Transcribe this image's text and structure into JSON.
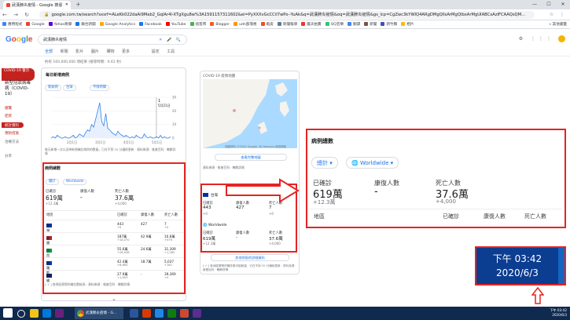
{
  "browser": {
    "tab_title": "武漢肺炎疫情 - Google 搜尋",
    "new_tab": "+",
    "url": "google.com.tw/search?sxsrf=ALeKk022daAi9Mab2_GqlAr4l-XTgXgu8w%3A1591157311602&ei=PyXXXvGcCCiI7wPo--YuAk&q=武漢肺炎疫情&oq=武漢肺炎疫情&gs_lcp=CgZwc3kYWlQ4ARgDMgQIlsArMgQIbxArMgUIABCxAzlFCAAQsQM...",
    "nav": "← → ↻",
    "right_icons": "☆ ⋮",
    "window_buttons": [
      "—",
      "☐",
      "✕"
    ]
  },
  "bookmarks": [
    {
      "label": "應用程式",
      "color": "#4285f4"
    },
    {
      "label": "Google",
      "color": "#ea4335"
    },
    {
      "label": "Yahoo奇摩",
      "color": "#6001d2"
    },
    {
      "label": "聯合新聞",
      "color": "#1a73e8"
    },
    {
      "label": "Google Analytics",
      "color": "#f9ab00"
    },
    {
      "label": "Facebook",
      "color": "#1877f2"
    },
    {
      "label": "YouTube",
      "color": "#ff0000"
    },
    {
      "label": "痞客邦",
      "color": "#4caf50"
    },
    {
      "label": "Blogger",
      "color": "#ff5722"
    },
    {
      "label": "udn部落格",
      "color": "#ff9800"
    },
    {
      "label": "蝦皮",
      "color": "#ee4d2d"
    },
    {
      "label": "新聞報導",
      "color": "#607d8b"
    },
    {
      "label": "露天拍賣",
      "color": "#e53935"
    },
    {
      "label": "QQ音樂",
      "color": "#31c27c"
    },
    {
      "label": "翻譯",
      "color": "#4285f4"
    },
    {
      "label": "新聞",
      "color": "#795548"
    },
    {
      "label": "新竹縣",
      "color": "#3f51b5"
    },
    {
      "label": "相片",
      "color": "#fbbc05"
    }
  ],
  "bookmarks_more": "» 其他書籤",
  "google": {
    "logo": [
      "G",
      "o",
      "o",
      "g",
      "l",
      "e"
    ],
    "query": "武漢肺炎疫情",
    "search_icons": "✕ 🎤 🔍",
    "header_right": "⚙ ⋮⋮⋮",
    "tabs": [
      "全部",
      "新聞",
      "影片",
      "圖片",
      "購物",
      "更多",
      "設定",
      "工具"
    ],
    "result_stats": "約有 160,000,000 項結果 (搜尋時間：0.61 秒)"
  },
  "sidebar": {
    "badge": "COVID-19 警示",
    "title": "新型冠狀病毒病（COVID-19）",
    "links": [
      "總覽",
      "症狀",
      "預防措施",
      "治療方法"
    ],
    "active": "統計資料",
    "share": "分享"
  },
  "main_card": {
    "title": "每日新增病例",
    "chips": [
      "新病例",
      "台灣",
      "不限時間"
    ],
    "chart_tooltip": [
      "1",
      "5月21日"
    ],
    "chart_note": "每天新增一次以反映新增確診病例的數量。已在不到 20 分鐘前更新 · 資料來源：維基百科 · 瞭解詳情"
  },
  "chart_data": {
    "type": "line",
    "title": "",
    "x_ticks": [
      "2月1日",
      "3月1日",
      "4月1日",
      "5月1日"
    ],
    "y_ticks": [
      "0",
      "10",
      "20",
      "30"
    ],
    "ylim": [
      0,
      30
    ],
    "values": [
      0,
      1,
      0,
      2,
      1,
      0,
      0,
      1,
      0,
      0,
      1,
      2,
      0,
      1,
      3,
      2,
      1,
      4,
      6,
      5,
      10,
      8,
      14,
      20,
      26,
      12,
      9,
      18,
      7,
      6,
      4,
      3,
      2,
      5,
      3,
      2,
      1,
      2,
      1,
      0,
      1,
      0,
      2,
      1,
      0,
      0,
      3,
      1,
      0,
      1,
      0,
      0,
      1,
      0,
      2,
      0,
      1,
      0,
      0,
      1
    ],
    "colors": {
      "line": "#1a73e8",
      "fill": "#e8f0fe"
    }
  },
  "left_table": {
    "title": "病例總數",
    "chips": [
      "總計",
      "Worldwide"
    ],
    "summary": [
      {
        "label": "已確診",
        "value": "619萬",
        "sub": "+12.3萬"
      },
      {
        "label": "康復人數",
        "value": "-",
        "sub": ""
      },
      {
        "label": "死亡人數",
        "value": "37.6萬",
        "sub": "+4,000"
      }
    ],
    "columns": [
      "地區",
      "已確診",
      "康復人數",
      "死亡人數"
    ],
    "rows": [
      {
        "name": "台灣",
        "flag": "#0033a0",
        "c": "443",
        "c2": "+0",
        "r": "427",
        "d": "7",
        "d2": "+0"
      },
      {
        "name": "美國",
        "flag": "#b22234",
        "c": "187萬",
        "c2": "+18,070",
        "r": "42.9萬",
        "d": "10.8萬",
        "d2": "+476"
      },
      {
        "name": "巴西",
        "flag": "#009c3b",
        "c": "55.6萬",
        "c2": "+28,936",
        "r": "24.6萬",
        "d": "31,309",
        "d2": "+1,262"
      },
      {
        "name": "俄羅斯",
        "flag": "#0039a6",
        "c": "42.4萬",
        "c2": "+8,863",
        "r": "18.7萬",
        "d": "5,037",
        "d2": "+182"
      },
      {
        "name": "英國",
        "flag": "#012169",
        "c": "27.9萬",
        "c2": "+1,653",
        "r": "-",
        "d": "39,369",
        "d2": "+0"
      }
    ],
    "footnote": "[ + ] 各地區實際的確診數較高 · 資料來源：維基百科 · 瞭解詳情",
    "expand": "⌄"
  },
  "mid_card": {
    "title": "COVID-19 疫情地圖",
    "map_caption": "地圖資料 ©2020 Google, SK telecom 使用條款",
    "btn_map": "查看完整地圖",
    "source": "資料來源 · 維基百科 · 瞭解詳情",
    "region1": "台灣",
    "region2": "Worldwide",
    "stats1": [
      {
        "label": "已確診",
        "value": "443",
        "sub": "+0"
      },
      {
        "label": "康復人數",
        "value": "427",
        "sub": ""
      },
      {
        "label": "死亡人數",
        "value": "7",
        "sub": "+0"
      }
    ],
    "stats2": [
      {
        "label": "已確診",
        "value": "619萬",
        "sub": "+12.3萬"
      },
      {
        "label": "康復人數",
        "value": "-",
        "sub": ""
      },
      {
        "label": "死亡人數",
        "value": "37.6萬",
        "sub": "+4,000"
      }
    ],
    "btn_more": "其他地區的詳細資料",
    "footnote": "[ + ] 各地區實際的確診數可能較高 · 已在不到 20 分鐘前更新 · 資料來源 · 維基百科 · 瞭解詳情"
  },
  "zoom_panel": {
    "title": "病例總數",
    "chip1": "總計 ▾",
    "chip2": "🌐 Worldwide ▾",
    "summary": [
      {
        "label": "已確診",
        "value": "619萬",
        "sub": "+12.3萬"
      },
      {
        "label": "康復人數",
        "value": "-",
        "sub": ""
      },
      {
        "label": "死亡人數",
        "value": "37.6萬",
        "sub": "+4,000"
      }
    ],
    "columns": [
      "地區",
      "已確診",
      "康復人數",
      "死亡人數"
    ]
  },
  "zoom_clock": {
    "time": "下午 03:42",
    "date": "2020/6/3"
  },
  "taskbar": {
    "chrome_label": "武漢肺炎疫情 - G...",
    "tray_time": "下午 03:42",
    "tray_date": "2020/6/3",
    "pinned_colors": [
      "#f0c419",
      "#0078d7",
      "#68217a",
      "#2b579a",
      "#d83b01",
      "#1e88e5",
      "#107c10",
      "#cc4a31",
      "#5c2d91"
    ]
  }
}
